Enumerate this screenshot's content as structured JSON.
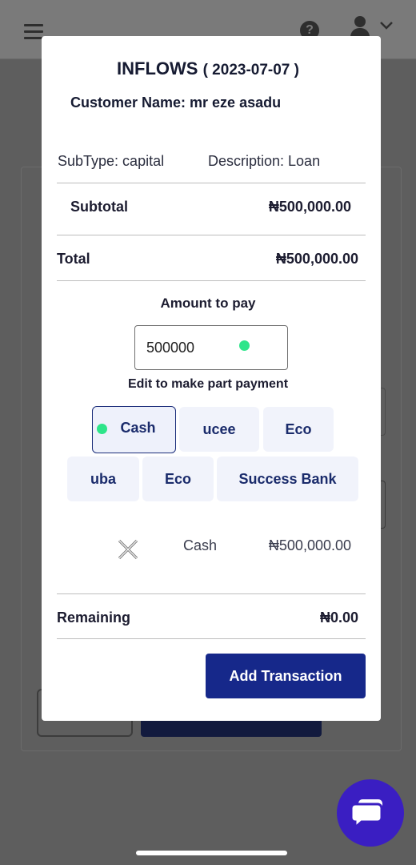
{
  "modal": {
    "title": "INFLOWS",
    "date": "( 2023-07-07 )",
    "customer_name": "Customer Name: mr eze asadu",
    "subtype": "SubType: capital",
    "description": "Description: Loan",
    "subtotal_label": "Subtotal",
    "subtotal_value": "₦500,000.00",
    "total_label": "Total",
    "total_value": "₦500,000.00",
    "amount_label": "Amount to pay",
    "amount_value": "500000",
    "edit_hint": "Edit to make part payment",
    "payment_options": [
      "Cash",
      "ucee",
      "Eco",
      "uba",
      "Eco",
      "Success Bank"
    ],
    "selected_payment": "Cash",
    "selected_payment_row": {
      "method": "Cash",
      "amount": "₦500,000.00"
    },
    "remaining_label": "Remaining",
    "remaining_value": "₦0.00",
    "add_button": "Add Transaction"
  },
  "colors": {
    "primary": "#16288a",
    "chip_bg": "#f1f3fb",
    "indicator": "#2ee58a",
    "chat_fab": "#3a1ec2",
    "overlay": "#5e5e5e"
  },
  "icons": {
    "header_left": "hamburger-menu-icon",
    "header_help": "help-icon",
    "header_user": "user-icon",
    "header_dropdown": "chevron-down-icon",
    "remove_payment": "close-icon",
    "chat": "chat-icon"
  }
}
